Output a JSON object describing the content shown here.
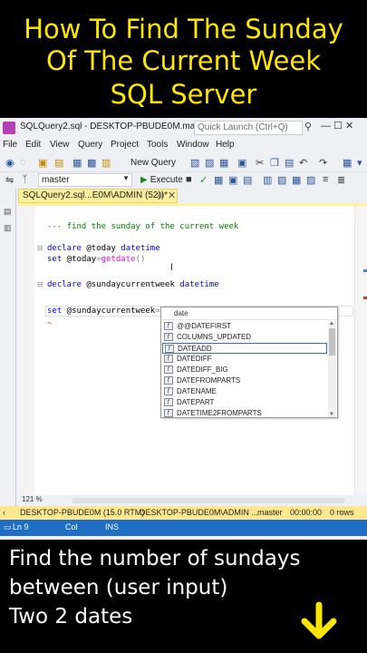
{
  "banner": {
    "line1": "How To Find The Sunday",
    "line2": "Of The Current Week",
    "line3": "SQL Server"
  },
  "window": {
    "title": "SQLQuery2.sql - DESKTOP-PBUDE0M.master (...",
    "quick_launch_placeholder": "Quick Launch (Ctrl+Q)",
    "controls": "—  ☐  ✕"
  },
  "menu": [
    "File",
    "Edit",
    "View",
    "Query",
    "Project",
    "Tools",
    "Window",
    "Help"
  ],
  "toolbar": {
    "new_query": "New Query",
    "database": "master",
    "execute": "Execute"
  },
  "tab": {
    "label": "SQLQuery2.sql...E0M\\ADMIN (52))*",
    "pin": "⊕",
    "close": "✕"
  },
  "code": {
    "comment": "--- find the sunday of the current week",
    "l1_kw": "declare",
    "l1_var": " @today ",
    "l1_type": "datetime",
    "l2_kw": "set",
    "l2_var": " @today",
    "l2_eq": "=",
    "l2_fn": "getdate",
    "l2_paren": "()",
    "l3_kw": "declare",
    "l3_var": " @sundaycurrentweek ",
    "l3_type": "datetime",
    "l4_kw": "set",
    "l4_var": " @sundaycurrentweek",
    "l4_eq": "=",
    "l4_typed": "date",
    "squiggle": "~"
  },
  "autocomplete": {
    "header": "date",
    "items": [
      "@@DATEFIRST",
      "COLUMNS_UPDATED",
      "DATEADD",
      "DATEDIFF",
      "DATEDIFF_BIG",
      "DATEFROMPARTS",
      "DATENAME",
      "DATEPART",
      "DATETIME2FROMPARTS"
    ],
    "selected_index": 2
  },
  "zoom": "121 %",
  "sql_status": {
    "server": "DESKTOP-PBUDE0M (15.0 RTM)",
    "login": "DESKTOP-PBUDE0M\\ADMIN ...",
    "db": "master",
    "time": "00:00:00",
    "rows": "0 rows"
  },
  "app_status": {
    "ln": "Ln 9",
    "col": "Col",
    "ins": "INS"
  },
  "caption": {
    "line1": "Find the number of sundays",
    "line2": "between (user input)",
    "line3": "Two 2 dates"
  },
  "colors": {
    "banner_text": "#ffe600",
    "arrow": "#ffe600",
    "tab": "#fff09e",
    "app_status": "#1e6fc4"
  }
}
